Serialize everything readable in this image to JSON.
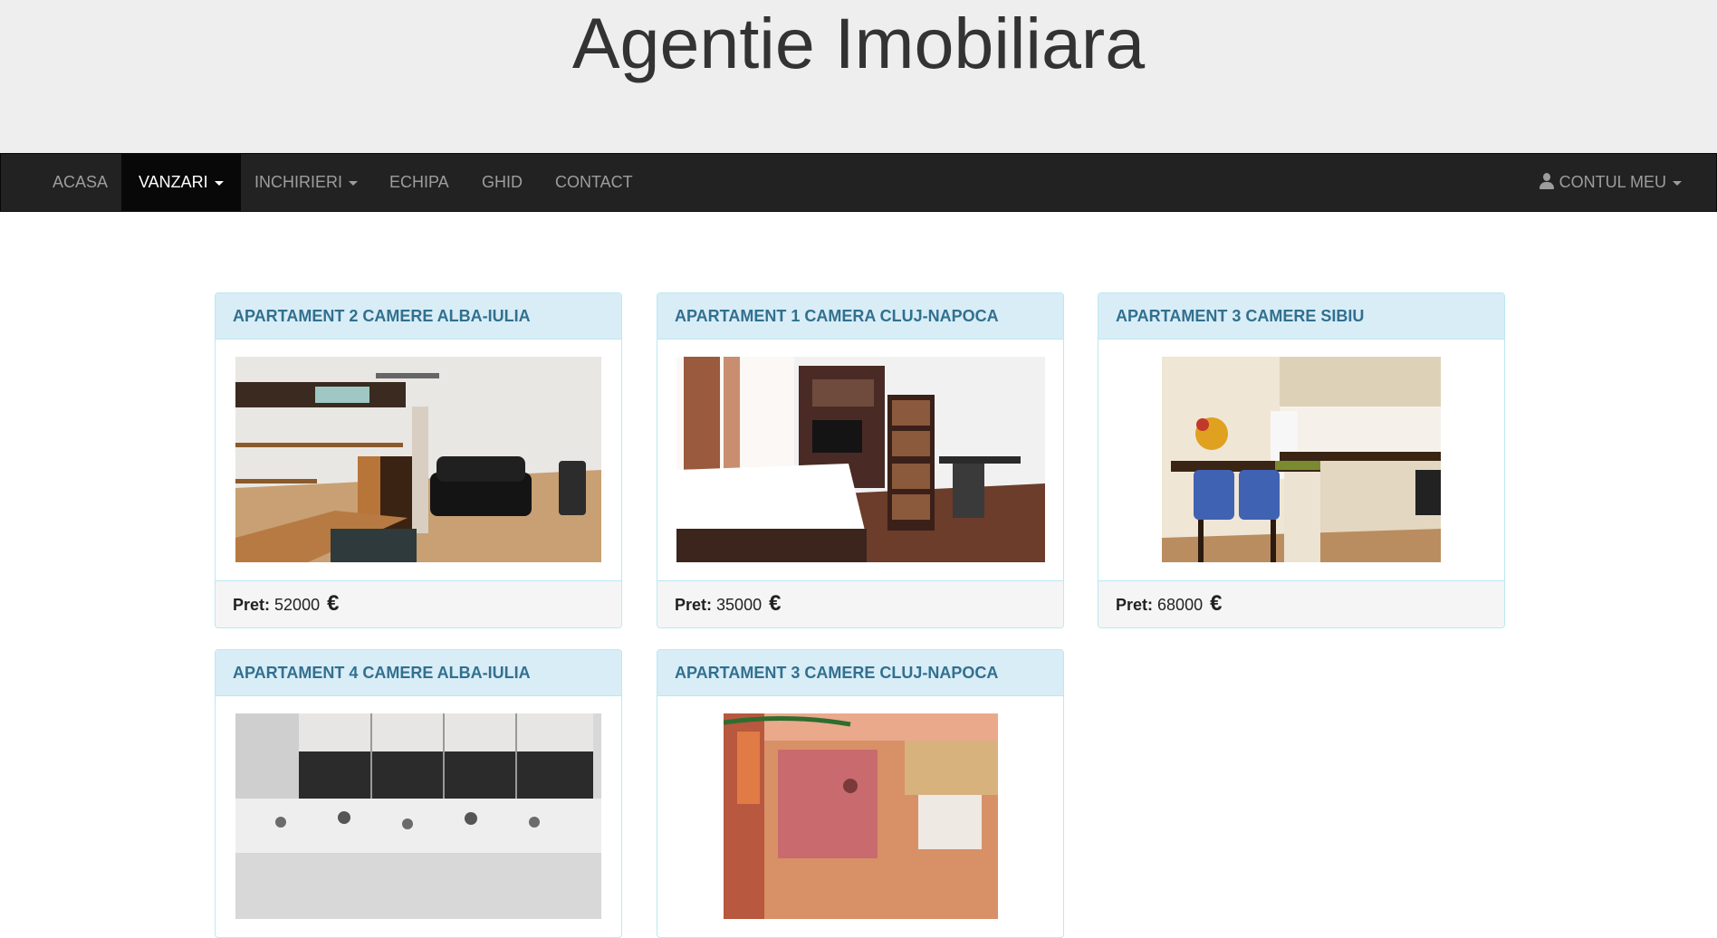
{
  "header": {
    "title": "Agentie Imobiliara"
  },
  "nav": {
    "items": [
      {
        "label": "ACASA"
      },
      {
        "label": "VANZARI"
      },
      {
        "label": "INCHIRIERI"
      },
      {
        "label": "ECHIPA"
      },
      {
        "label": "GHID"
      },
      {
        "label": "CONTACT"
      }
    ],
    "account": {
      "label": "CONTUL MEU",
      "icon": "user-icon"
    }
  },
  "listings": [
    {
      "title": "APARTAMENT 2 CAMERE ALBA-IULIA",
      "price_label": "Pret:",
      "price": "52000",
      "currency": "€"
    },
    {
      "title": "APARTAMENT 1 CAMERA CLUJ-NAPOCA",
      "price_label": "Pret:",
      "price": "35000",
      "currency": "€"
    },
    {
      "title": "APARTAMENT 3 CAMERE SIBIU",
      "price_label": "Pret:",
      "price": "68000",
      "currency": "€"
    },
    {
      "title": "APARTAMENT 4 CAMERE ALBA-IULIA"
    },
    {
      "title": "APARTAMENT 3 CAMERE CLUJ-NAPOCA"
    }
  ],
  "colors": {
    "nav_background": "#222222",
    "nav_active": "#080808",
    "panel_heading_background": "#d9edf7",
    "panel_heading_text": "#31708f"
  }
}
